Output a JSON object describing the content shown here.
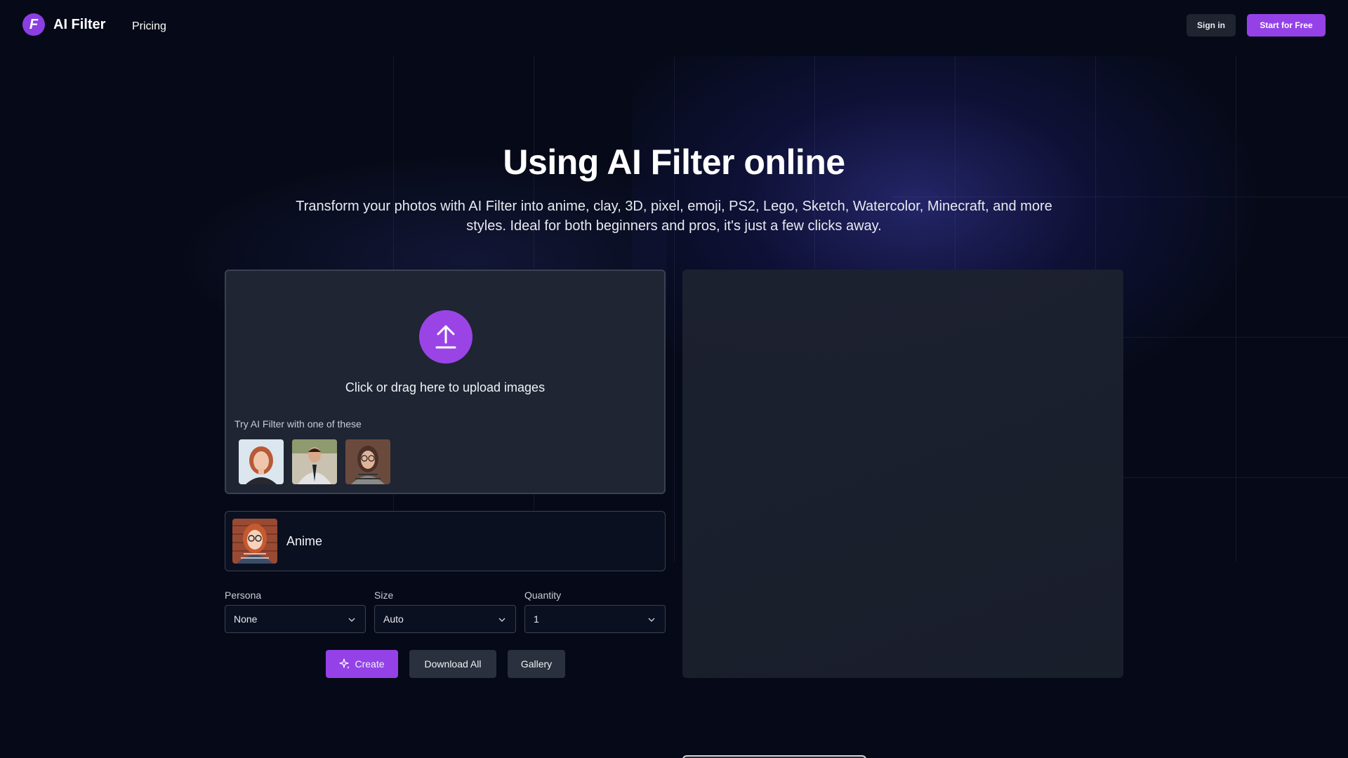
{
  "header": {
    "brand": "AI Filter",
    "logo_letter": "F",
    "nav": {
      "pricing": "Pricing"
    },
    "sign_in": "Sign in",
    "start_free": "Start for Free"
  },
  "hero": {
    "title": "Using AI Filter online",
    "subtitle": "Transform your photos with AI Filter into anime, clay, 3D, pixel, emoji, PS2, Lego, Sketch, Watercolor, Minecraft, and more styles. Ideal for both beginners and pros, it's just a few clicks away."
  },
  "upload": {
    "prompt": "Click or drag here to upload images",
    "try_label": "Try AI Filter with one of these",
    "samples": [
      "sample-woman-red-hair",
      "sample-man-suit",
      "sample-woman-glasses"
    ]
  },
  "style": {
    "selected": "Anime"
  },
  "options": {
    "persona": {
      "label": "Persona",
      "value": "None"
    },
    "size": {
      "label": "Size",
      "value": "Auto"
    },
    "quantity": {
      "label": "Quantity",
      "value": "1"
    }
  },
  "actions": {
    "create": "Create",
    "download_all": "Download All",
    "gallery": "Gallery"
  },
  "colors": {
    "accent": "#9442e8",
    "background": "#060a18",
    "panel": "#1f2533"
  }
}
